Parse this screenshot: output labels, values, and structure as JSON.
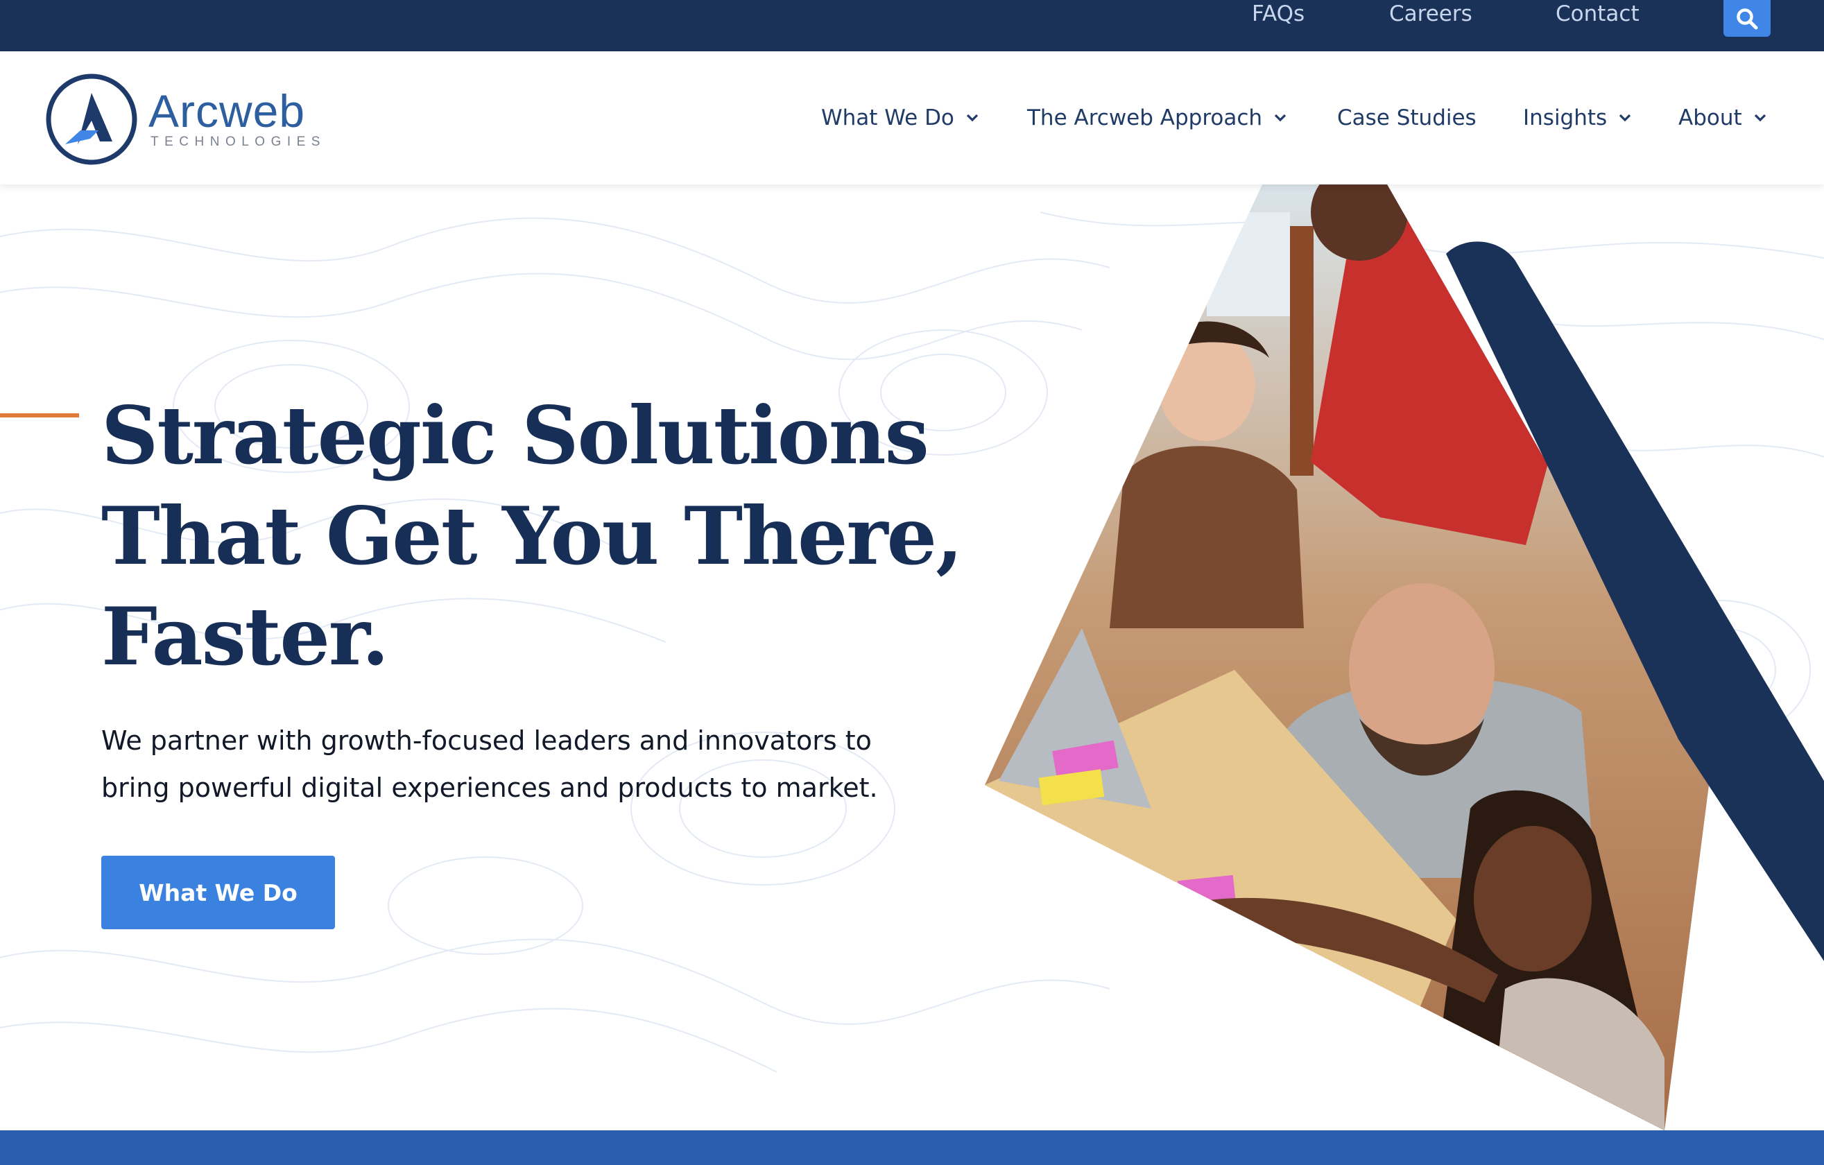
{
  "topbar": {
    "links": [
      {
        "label": "FAQs"
      },
      {
        "label": "Careers"
      },
      {
        "label": "Contact"
      }
    ],
    "search_icon": "search-icon"
  },
  "logo": {
    "word": "Arcweb",
    "sub": "TECHNOLOGIES"
  },
  "nav": {
    "items": [
      {
        "label": "What We Do",
        "has_dropdown": true
      },
      {
        "label": "The Arcweb Approach",
        "has_dropdown": true
      },
      {
        "label": "Case Studies",
        "has_dropdown": false
      },
      {
        "label": "Insights",
        "has_dropdown": true
      },
      {
        "label": "About",
        "has_dropdown": true
      }
    ]
  },
  "hero": {
    "headline_lines": [
      "Strategic Solutions",
      "That Get You There,",
      "Faster."
    ],
    "subtext_lines": [
      "We partner with growth-focused leaders and innovators to",
      "bring powerful digital experiences and products to market."
    ],
    "cta_label": "What We Do"
  },
  "colors": {
    "navy": "#1a3158",
    "brand_blue": "#3b82e0",
    "accent_orange": "#e07b3a",
    "headline": "#172f57"
  }
}
